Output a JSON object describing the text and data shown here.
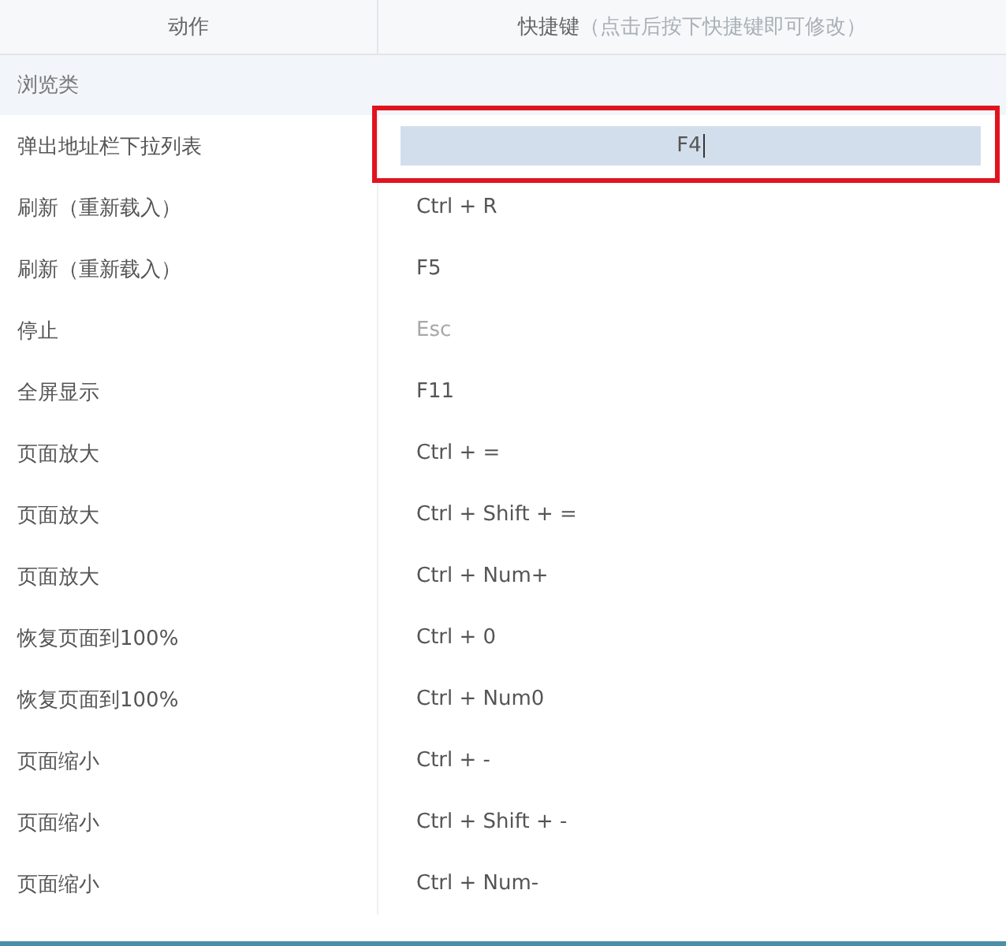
{
  "table": {
    "columns": [
      {
        "label": "动作"
      },
      {
        "label": "快捷键",
        "hint": "（点击后按下快捷键即可修改）"
      }
    ],
    "category": "浏览类",
    "rows": [
      {
        "action": "弹出地址栏下拉列表",
        "shortcut": "F4",
        "selected": true,
        "disabled": false
      },
      {
        "action": "刷新（重新载入）",
        "shortcut": "Ctrl + R",
        "selected": false,
        "disabled": false
      },
      {
        "action": "刷新（重新载入）",
        "shortcut": "F5",
        "selected": false,
        "disabled": false
      },
      {
        "action": "停止",
        "shortcut": "Esc",
        "selected": false,
        "disabled": true
      },
      {
        "action": "全屏显示",
        "shortcut": "F11",
        "selected": false,
        "disabled": false
      },
      {
        "action": "页面放大",
        "shortcut": "Ctrl + =",
        "selected": false,
        "disabled": false
      },
      {
        "action": "页面放大",
        "shortcut": "Ctrl + Shift + =",
        "selected": false,
        "disabled": false
      },
      {
        "action": "页面放大",
        "shortcut": "Ctrl + Num+",
        "selected": false,
        "disabled": false
      },
      {
        "action": "恢复页面到100%",
        "shortcut": "Ctrl + 0",
        "selected": false,
        "disabled": false
      },
      {
        "action": "恢复页面到100%",
        "shortcut": "Ctrl + Num0",
        "selected": false,
        "disabled": false
      },
      {
        "action": "页面缩小",
        "shortcut": "Ctrl + -",
        "selected": false,
        "disabled": false
      },
      {
        "action": "页面缩小",
        "shortcut": "Ctrl + Shift + -",
        "selected": false,
        "disabled": false
      },
      {
        "action": "页面缩小",
        "shortcut": "Ctrl + Num-",
        "selected": false,
        "disabled": false
      }
    ]
  }
}
